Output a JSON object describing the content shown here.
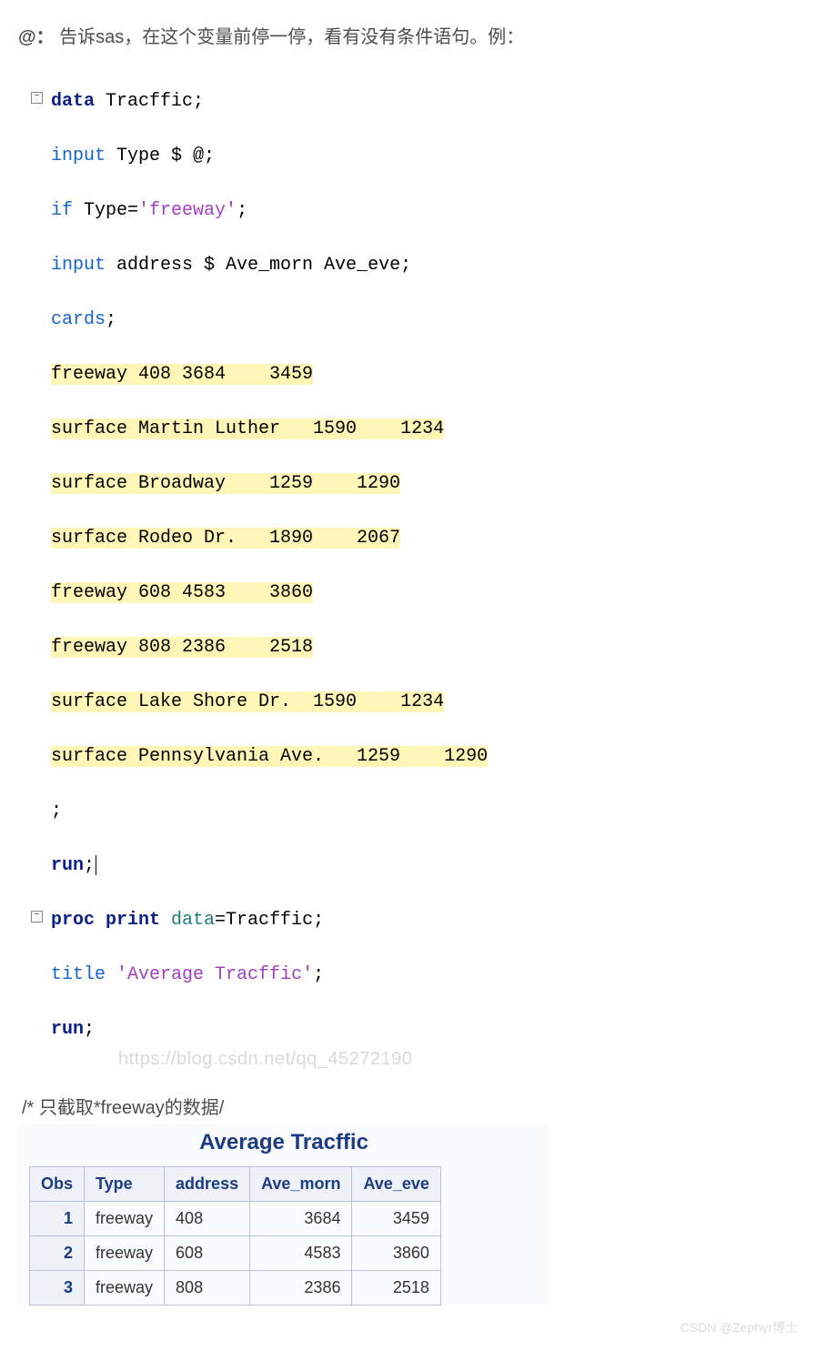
{
  "headline_prefix": "@：",
  "headline_rest": " 告诉sas，在这个变量前停一停，看有没有条件语句。例：",
  "code": {
    "l1_kw": "data",
    "l1_rest": " Tracffic;",
    "l2_kw": "input",
    "l2_rest": " Type $ @;",
    "l3_kw": "if",
    "l3_mid": " Type=",
    "l3_str": "'freeway'",
    "l3_end": ";",
    "l4_kw": "input",
    "l4_rest": " address $ Ave_morn Ave_eve;",
    "l5_kw": "cards",
    "l5_rest": ";",
    "d1": "freeway 408 3684    3459",
    "d2": "surface Martin Luther   1590    1234",
    "d3": "surface Broadway    1259    1290",
    "d4": "surface Rodeo Dr.   1890    2067",
    "d5": "freeway 608 4583    3860",
    "d6": "freeway 808 2386    2518",
    "d7": "surface Lake Shore Dr.  1590    1234",
    "d8": "surface Pennsylvania Ave.   1259    1290",
    "semi": ";",
    "run": "run",
    "run_end": ";",
    "p1_kw": "proc print",
    "p1_opt": " data",
    "p1_rest": "=Tracffic;",
    "p2_kw": "title",
    "p2_sp": " ",
    "p2_str": "'Average Tracffic'",
    "p2_end": ";",
    "p3_kw": "run",
    "p3_end": ";"
  },
  "watermark": "https://blog.csdn.net/qq_45272190",
  "comment": "/* 只截取*freeway的数据/",
  "result_title": "Average Tracffic",
  "columns": [
    "Obs",
    "Type",
    "address",
    "Ave_morn",
    "Ave_eve"
  ],
  "rows": [
    {
      "obs": "1",
      "type": "freeway",
      "address": "408",
      "morn": "3684",
      "eve": "3459"
    },
    {
      "obs": "2",
      "type": "freeway",
      "address": "608",
      "morn": "4583",
      "eve": "3860"
    },
    {
      "obs": "3",
      "type": "freeway",
      "address": "808",
      "morn": "2386",
      "eve": "2518"
    }
  ],
  "chart_data": {
    "type": "table",
    "title": "Average Tracffic",
    "columns": [
      "Obs",
      "Type",
      "address",
      "Ave_morn",
      "Ave_eve"
    ],
    "data": [
      [
        1,
        "freeway",
        "408",
        3684,
        3459
      ],
      [
        2,
        "freeway",
        "608",
        4583,
        3860
      ],
      [
        3,
        "freeway",
        "808",
        2386,
        2518
      ]
    ]
  },
  "footer_wm": "CSDN @Zephyr博士"
}
